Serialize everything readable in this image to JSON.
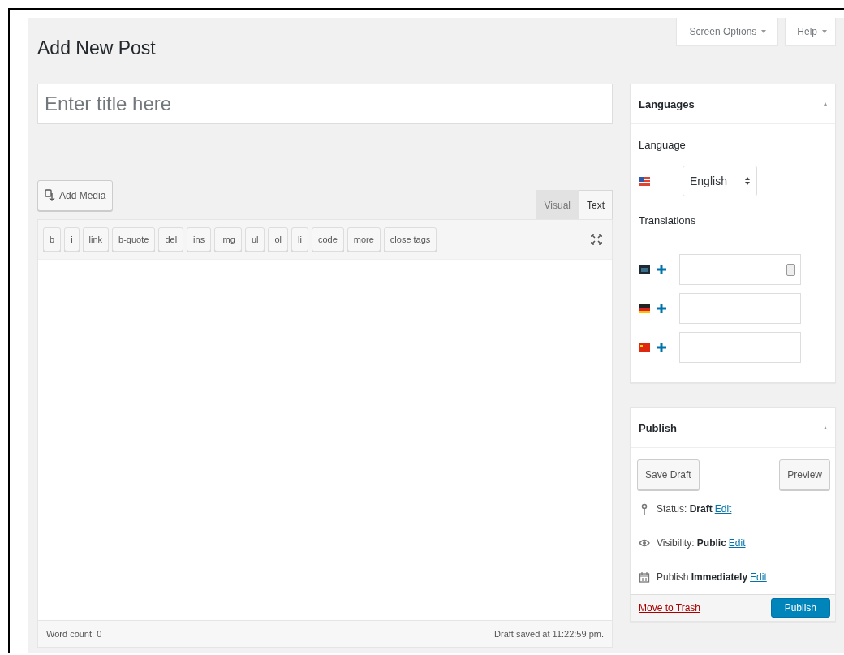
{
  "page_title": "Add New Post",
  "screen_meta": [
    {
      "label": "Screen Options"
    },
    {
      "label": "Help"
    }
  ],
  "title_field": {
    "placeholder": "Enter title here"
  },
  "add_media": {
    "label": "Add Media"
  },
  "editor_tabs": [
    {
      "label": "Visual",
      "selected": false
    },
    {
      "label": "Text",
      "selected": true
    }
  ],
  "quicktags": [
    "b",
    "i",
    "link",
    "b-quote",
    "del",
    "ins",
    "img",
    "ul",
    "ol",
    "li",
    "code",
    "more",
    "close tags"
  ],
  "status_bar": {
    "word_count": "Word count: 0",
    "saved": "Draft saved at 11:22:59 pm."
  },
  "languages_box": {
    "title": "Languages",
    "language_label": "Language",
    "language_value": "English",
    "translations_label": "Translations",
    "translations": [
      {
        "kind": "dark",
        "has_button": true
      },
      {
        "kind": "de",
        "has_button": false
      },
      {
        "kind": "cn",
        "has_button": false
      }
    ]
  },
  "publish_box": {
    "title": "Publish",
    "save_draft": "Save Draft",
    "preview": "Preview",
    "meta": [
      {
        "kind": "status",
        "text": "Status: **Draft**",
        "link": "Edit"
      },
      {
        "kind": "visibility",
        "text": "Visibility: **Public**",
        "link": "Edit"
      },
      {
        "kind": "schedule",
        "text": "Publish **Immediately**",
        "link": "Edit"
      }
    ],
    "trash": "Move to Trash",
    "publish": "Publish"
  }
}
